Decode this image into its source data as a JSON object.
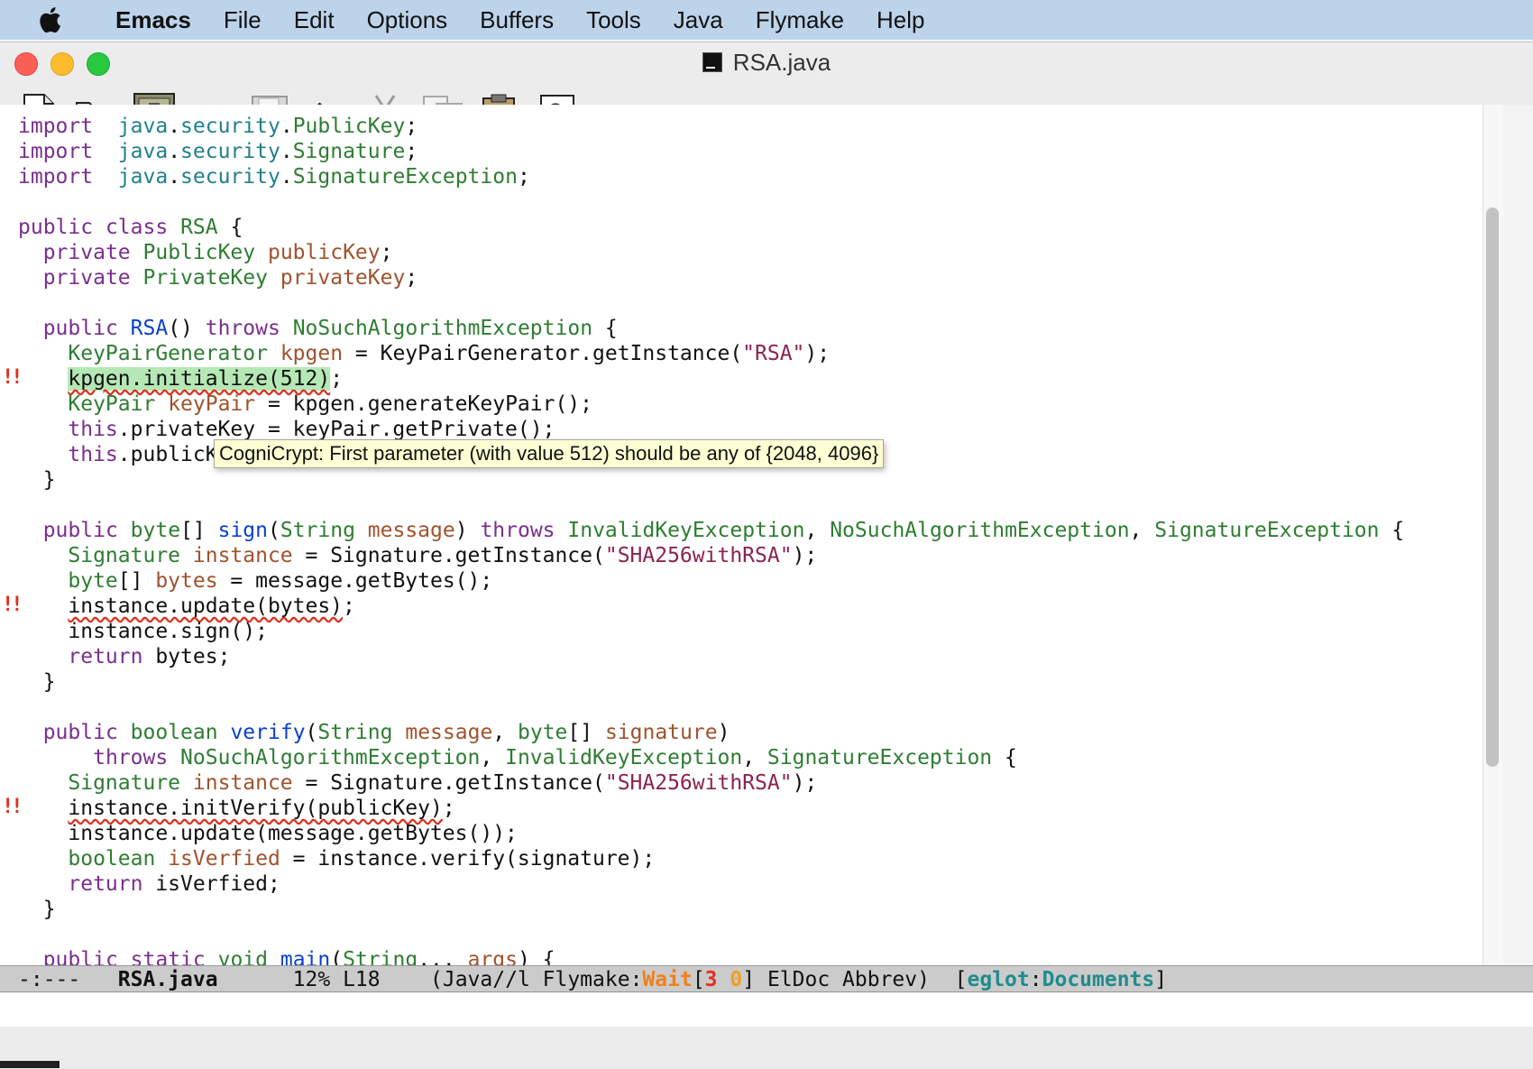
{
  "menubar": {
    "app_name": "Emacs",
    "items": [
      "File",
      "Edit",
      "Options",
      "Buffers",
      "Tools",
      "Java",
      "Flymake",
      "Help"
    ]
  },
  "window": {
    "title": "RSA.java"
  },
  "toolbar": {
    "buttons": [
      "new-file",
      "open-folder",
      "dired",
      "close",
      "save",
      "undo",
      "cut",
      "copy",
      "paste",
      "search"
    ]
  },
  "editor": {
    "tooltip": "CogniCrypt: First parameter (with value 512) should be any of {2048, 4096}",
    "error_markers": [
      {
        "line": 11,
        "glyph": "!!"
      },
      {
        "line": 20,
        "glyph": "!!"
      },
      {
        "line": 28,
        "glyph": "!!"
      }
    ],
    "lines": [
      [
        [
          "kw",
          "import"
        ],
        [
          "",
          "  "
        ],
        [
          "pk",
          "java"
        ],
        [
          "",
          "."
        ],
        [
          "pk",
          "security"
        ],
        [
          "",
          "."
        ],
        [
          "ty",
          "PublicKey"
        ],
        [
          "",
          ";"
        ]
      ],
      [
        [
          "kw",
          "import"
        ],
        [
          "",
          "  "
        ],
        [
          "pk",
          "java"
        ],
        [
          "",
          "."
        ],
        [
          "pk",
          "security"
        ],
        [
          "",
          "."
        ],
        [
          "ty",
          "Signature"
        ],
        [
          "",
          ";"
        ]
      ],
      [
        [
          "kw",
          "import"
        ],
        [
          "",
          "  "
        ],
        [
          "pk",
          "java"
        ],
        [
          "",
          "."
        ],
        [
          "pk",
          "security"
        ],
        [
          "",
          "."
        ],
        [
          "ty",
          "SignatureException"
        ],
        [
          "",
          ";"
        ]
      ],
      [],
      [
        [
          "kw",
          "public"
        ],
        [
          "",
          " "
        ],
        [
          "kw",
          "class"
        ],
        [
          "",
          " "
        ],
        [
          "ty",
          "RSA"
        ],
        [
          "",
          " {"
        ]
      ],
      [
        [
          "",
          "  "
        ],
        [
          "kw",
          "private"
        ],
        [
          "",
          " "
        ],
        [
          "ty",
          "PublicKey"
        ],
        [
          "",
          " "
        ],
        [
          "va",
          "publicKey"
        ],
        [
          "",
          ";"
        ]
      ],
      [
        [
          "",
          "  "
        ],
        [
          "kw",
          "private"
        ],
        [
          "",
          " "
        ],
        [
          "ty",
          "PrivateKey"
        ],
        [
          "",
          " "
        ],
        [
          "va",
          "privateKey"
        ],
        [
          "",
          ";"
        ]
      ],
      [],
      [
        [
          "",
          "  "
        ],
        [
          "kw",
          "public"
        ],
        [
          "",
          " "
        ],
        [
          "nm",
          "RSA"
        ],
        [
          "",
          "() "
        ],
        [
          "kw",
          "throws"
        ],
        [
          "",
          " "
        ],
        [
          "ty",
          "NoSuchAlgorithmException"
        ],
        [
          "",
          " {"
        ]
      ],
      [
        [
          "",
          "    "
        ],
        [
          "ty",
          "KeyPairGenerator"
        ],
        [
          "",
          " "
        ],
        [
          "va",
          "kpgen"
        ],
        [
          "",
          " = KeyPairGenerator.getInstance("
        ],
        [
          "st",
          "\"RSA\""
        ],
        [
          "",
          ");"
        ]
      ],
      [
        [
          "",
          "    "
        ],
        [
          "err hl",
          "kpgen.initialize(512)"
        ],
        [
          "",
          ";"
        ]
      ],
      [
        [
          "",
          "    "
        ],
        [
          "ty",
          "KeyPair"
        ],
        [
          "",
          " "
        ],
        [
          "va",
          "keyPair"
        ],
        [
          "",
          " = kpgen.generateKeyPair();"
        ]
      ],
      [
        [
          "",
          "    "
        ],
        [
          "kw",
          "this"
        ],
        [
          "",
          ".privateKey = keyPair.getPrivate();"
        ]
      ],
      [
        [
          "",
          "    "
        ],
        [
          "kw",
          "this"
        ],
        [
          "",
          ".publicKey = keyPair.getPublic();"
        ]
      ],
      [
        [
          "",
          "  }"
        ]
      ],
      [],
      [
        [
          "",
          "  "
        ],
        [
          "kw",
          "public"
        ],
        [
          "",
          " "
        ],
        [
          "ty",
          "byte"
        ],
        [
          "",
          "[] "
        ],
        [
          "nm",
          "sign"
        ],
        [
          "",
          "("
        ],
        [
          "ty",
          "String"
        ],
        [
          "",
          " "
        ],
        [
          "va",
          "message"
        ],
        [
          "",
          ") "
        ],
        [
          "kw",
          "throws"
        ],
        [
          "",
          " "
        ],
        [
          "ty",
          "InvalidKeyException"
        ],
        [
          "",
          ", "
        ],
        [
          "ty",
          "NoSuchAlgorithmException"
        ],
        [
          "",
          ", "
        ],
        [
          "ty",
          "SignatureException"
        ],
        [
          "",
          " {"
        ]
      ],
      [
        [
          "",
          "    "
        ],
        [
          "ty",
          "Signature"
        ],
        [
          "",
          " "
        ],
        [
          "va",
          "instance"
        ],
        [
          "",
          " = Signature.getInstance("
        ],
        [
          "st",
          "\"SHA256withRSA\""
        ],
        [
          "",
          ");"
        ]
      ],
      [
        [
          "",
          "    "
        ],
        [
          "ty",
          "byte"
        ],
        [
          "",
          "[] "
        ],
        [
          "va",
          "bytes"
        ],
        [
          "",
          " = message.getBytes();"
        ]
      ],
      [
        [
          "",
          "    "
        ],
        [
          "err",
          "instance.update(bytes)"
        ],
        [
          "",
          ";"
        ]
      ],
      [
        [
          "",
          "    instance.sign();"
        ]
      ],
      [
        [
          "",
          "    "
        ],
        [
          "kw",
          "return"
        ],
        [
          "",
          " bytes;"
        ]
      ],
      [
        [
          "",
          "  }"
        ]
      ],
      [],
      [
        [
          "",
          "  "
        ],
        [
          "kw",
          "public"
        ],
        [
          "",
          " "
        ],
        [
          "ty",
          "boolean"
        ],
        [
          "",
          " "
        ],
        [
          "nm",
          "verify"
        ],
        [
          "",
          "("
        ],
        [
          "ty",
          "String"
        ],
        [
          "",
          " "
        ],
        [
          "va",
          "message"
        ],
        [
          "",
          ", "
        ],
        [
          "ty",
          "byte"
        ],
        [
          "",
          "[] "
        ],
        [
          "va",
          "signature"
        ],
        [
          "",
          ")"
        ]
      ],
      [
        [
          "",
          "      "
        ],
        [
          "kw",
          "throws"
        ],
        [
          "",
          " "
        ],
        [
          "ty",
          "NoSuchAlgorithmException"
        ],
        [
          "",
          ", "
        ],
        [
          "ty",
          "InvalidKeyException"
        ],
        [
          "",
          ", "
        ],
        [
          "ty",
          "SignatureException"
        ],
        [
          "",
          " {"
        ]
      ],
      [
        [
          "",
          "    "
        ],
        [
          "ty",
          "Signature"
        ],
        [
          "",
          " "
        ],
        [
          "va",
          "instance"
        ],
        [
          "",
          " = Signature.getInstance("
        ],
        [
          "st",
          "\"SHA256withRSA\""
        ],
        [
          "",
          ");"
        ]
      ],
      [
        [
          "",
          "    "
        ],
        [
          "err",
          "instance.initVerify(publicKey)"
        ],
        [
          "",
          ";"
        ]
      ],
      [
        [
          "",
          "    instance.update(message.getBytes());"
        ]
      ],
      [
        [
          "",
          "    "
        ],
        [
          "ty",
          "boolean"
        ],
        [
          "",
          " "
        ],
        [
          "va",
          "isVerfied"
        ],
        [
          "",
          " = instance.verify(signature);"
        ]
      ],
      [
        [
          "",
          "    "
        ],
        [
          "kw",
          "return"
        ],
        [
          "",
          " isVerfied;"
        ]
      ],
      [
        [
          "",
          "  }"
        ]
      ],
      [],
      [
        [
          "",
          "  "
        ],
        [
          "kw",
          "public"
        ],
        [
          "",
          " "
        ],
        [
          "kw",
          "static"
        ],
        [
          "",
          " "
        ],
        [
          "ty",
          "void"
        ],
        [
          "",
          " "
        ],
        [
          "nm",
          "main"
        ],
        [
          "",
          "("
        ],
        [
          "ty",
          "String"
        ],
        [
          "",
          "... "
        ],
        [
          "va",
          "args"
        ],
        [
          "",
          ") {"
        ]
      ]
    ]
  },
  "modeline": {
    "status": "-:---",
    "buffer": "RSA.java",
    "position": "12%",
    "line": "L18",
    "mode_open": "(Java//l Flymake:",
    "flymake_state": "Wait",
    "error_count": "3",
    "warning_count": "0",
    "mode_close": "] ElDoc Abbrev)",
    "eglot_label": "eglot",
    "eglot_project": "Documents"
  },
  "scrollbar": {
    "position_fraction": 0.12,
    "visible_fraction": 0.65
  }
}
